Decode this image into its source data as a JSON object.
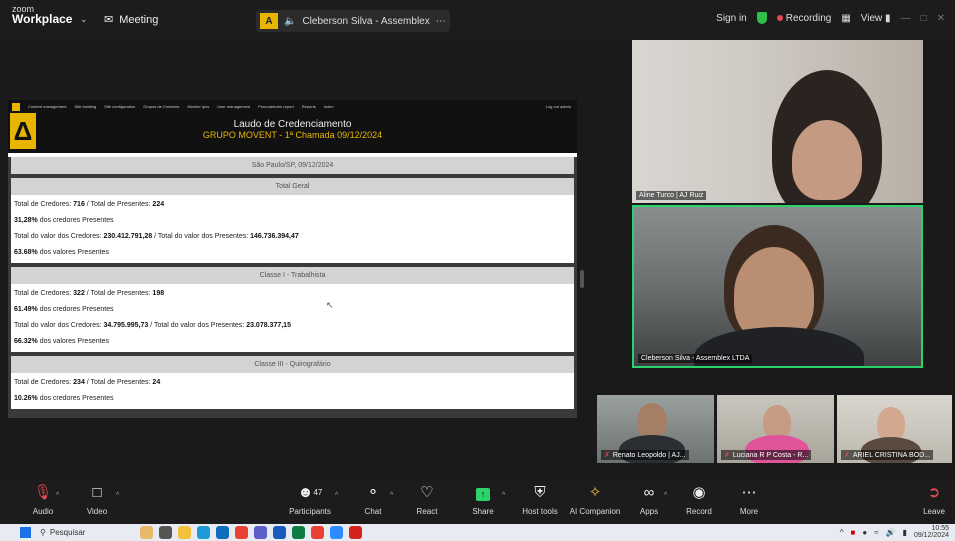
{
  "topbar": {
    "brand_line1": "zoom",
    "brand_line2": "Workplace",
    "meeting_label": "Meeting",
    "sharing_label": "Cleberson Silva - Assemblex",
    "share_logo": "A",
    "sign_in": "Sign in",
    "recording": "Recording",
    "view": "View"
  },
  "shared_screen": {
    "nav_items": [
      "Content management",
      "Site building",
      "Site configuration",
      "Grupos de Credores",
      "Monitor Ipcs",
      "User management",
      "Procuradores report",
      "Reports",
      "Index"
    ],
    "nav_right": "Log out admin",
    "logo_glyph": "Δ",
    "title": "Laudo de Credenciamento",
    "subtitle": "GRUPO MOVENT - 1ª Chamada 09/12/2024",
    "date_line": "São Paulo/SP, 09/12/2024",
    "sections": [
      {
        "header": "Total Geral",
        "lines": [
          {
            "pre": "Total de Credores: ",
            "v1": "716",
            "mid": " / Total de Presentes: ",
            "v2": "224"
          },
          {
            "pre": "",
            "v1": "31,28%",
            "mid": " dos credores Presentes",
            "v2": ""
          },
          {
            "pre": "Total do valor dos Credores: ",
            "v1": "230.412.791,28",
            "mid": " / Total do valor dos Presentes: ",
            "v2": "146.736.394,47"
          },
          {
            "pre": "",
            "v1": "63.68%",
            "mid": " dos valores Presentes",
            "v2": ""
          }
        ]
      },
      {
        "header": "Classe I - Trabalhista",
        "lines": [
          {
            "pre": "Total de Credores: ",
            "v1": "322",
            "mid": " / Total de Presentes: ",
            "v2": "198"
          },
          {
            "pre": "",
            "v1": "61.49%",
            "mid": " dos credores Presentes",
            "v2": ""
          },
          {
            "pre": "Total do valor dos Credores: ",
            "v1": "34.795.995,73",
            "mid": " / Total do valor dos Presentes: ",
            "v2": "23.078.377,15"
          },
          {
            "pre": "",
            "v1": "66.32%",
            "mid": " dos valores Presentes",
            "v2": ""
          }
        ]
      },
      {
        "header": "Classe III - Quirografário",
        "lines": [
          {
            "pre": "Total de Credores: ",
            "v1": "234",
            "mid": " / Total de Presentes: ",
            "v2": "24"
          },
          {
            "pre": "",
            "v1": "10.26%",
            "mid": " dos credores Presentes",
            "v2": ""
          }
        ]
      }
    ]
  },
  "participants": {
    "tile1_name": "Aline Turco | AJ Ruiz",
    "tile2_name": "Cleberson Silva - Assemblex LTDA",
    "tile3_name": "Renato Leopoldo | AJ...",
    "tile4_name": "Luciana R P Costa - R...",
    "tile5_name": "ARIEL CRISTINA BOD...",
    "active_speaker_color": "#2bd36a"
  },
  "toolbar": {
    "audio": "Audio",
    "video": "Video",
    "participants": "Participants",
    "participants_count": "47",
    "chat": "Chat",
    "react": "React",
    "share": "Share",
    "host_tools": "Host tools",
    "ai_companion": "AI Companion",
    "apps": "Apps",
    "record": "Record",
    "more": "More",
    "leave": "Leave"
  },
  "taskbar": {
    "search_placeholder": "Pesquisar",
    "time": "10:55",
    "date": "09/12/2024"
  }
}
